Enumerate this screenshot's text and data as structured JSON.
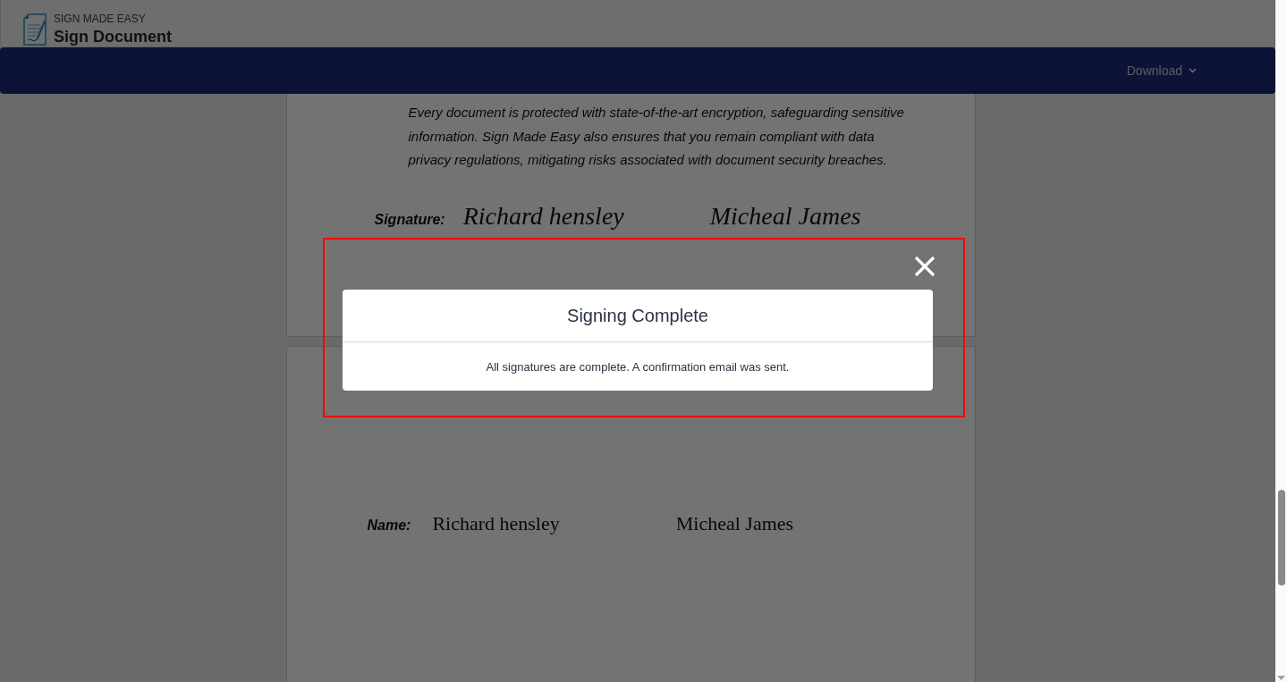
{
  "header": {
    "brand": "SIGN MADE EASY",
    "title": "Sign Document"
  },
  "toolbar": {
    "menu": "Download"
  },
  "document": {
    "paragraph": "Every document is protected with state-of-the-art encryption, safeguarding sensitive information. Sign Made Easy also ensures that you remain compliant with data privacy regulations, mitigating risks associated with document security breaches.",
    "signature_label": "Signature:",
    "signatures": [
      "Richard hensley",
      "Micheal James"
    ],
    "name_label": "Name:",
    "names": [
      "Richard hensley",
      "Micheal James"
    ]
  },
  "dialog": {
    "title": "Signing Complete",
    "message": "All signatures are complete. A confirmation email was sent."
  }
}
